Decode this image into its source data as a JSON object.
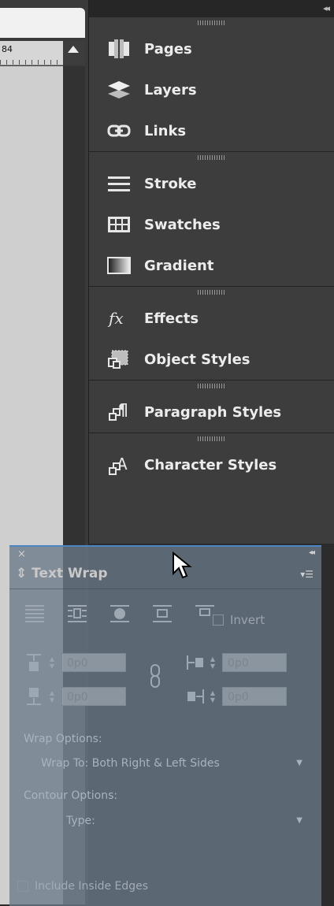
{
  "document": {
    "ruler_number": "84"
  },
  "panels": [
    {
      "items": [
        {
          "name": "pages",
          "label": "Pages",
          "icon": "pages-icon"
        },
        {
          "name": "layers",
          "label": "Layers",
          "icon": "layers-icon"
        },
        {
          "name": "links",
          "label": "Links",
          "icon": "links-icon"
        }
      ]
    },
    {
      "items": [
        {
          "name": "stroke",
          "label": "Stroke",
          "icon": "stroke-icon"
        },
        {
          "name": "swatches",
          "label": "Swatches",
          "icon": "swatches-icon"
        },
        {
          "name": "gradient",
          "label": "Gradient",
          "icon": "gradient-icon"
        }
      ]
    },
    {
      "items": [
        {
          "name": "effects",
          "label": "Effects",
          "icon": "effects-icon"
        },
        {
          "name": "object-styles",
          "label": "Object Styles",
          "icon": "object-styles-icon"
        }
      ]
    },
    {
      "items": [
        {
          "name": "paragraph-styles",
          "label": "Paragraph Styles",
          "icon": "paragraph-styles-icon"
        }
      ]
    },
    {
      "items": [
        {
          "name": "character-styles",
          "label": "Character Styles",
          "icon": "character-styles-icon"
        }
      ]
    }
  ],
  "text_wrap": {
    "title": "Text Wrap",
    "invert_label": "Invert",
    "top_offset": "0p0",
    "bottom_offset": "0p0",
    "left_offset": "0p0",
    "right_offset": "0p0",
    "wrap_options_label": "Wrap Options:",
    "wrap_to_value": "Wrap To:  Both Right & Left Sides",
    "contour_options_label": "Contour Options:",
    "type_value": "Type:",
    "include_edges_label": "Include Inside Edges"
  },
  "colors": {
    "dock_bg": "#3d3d3d",
    "label": "#ececec",
    "accent": "#4a85c4"
  }
}
